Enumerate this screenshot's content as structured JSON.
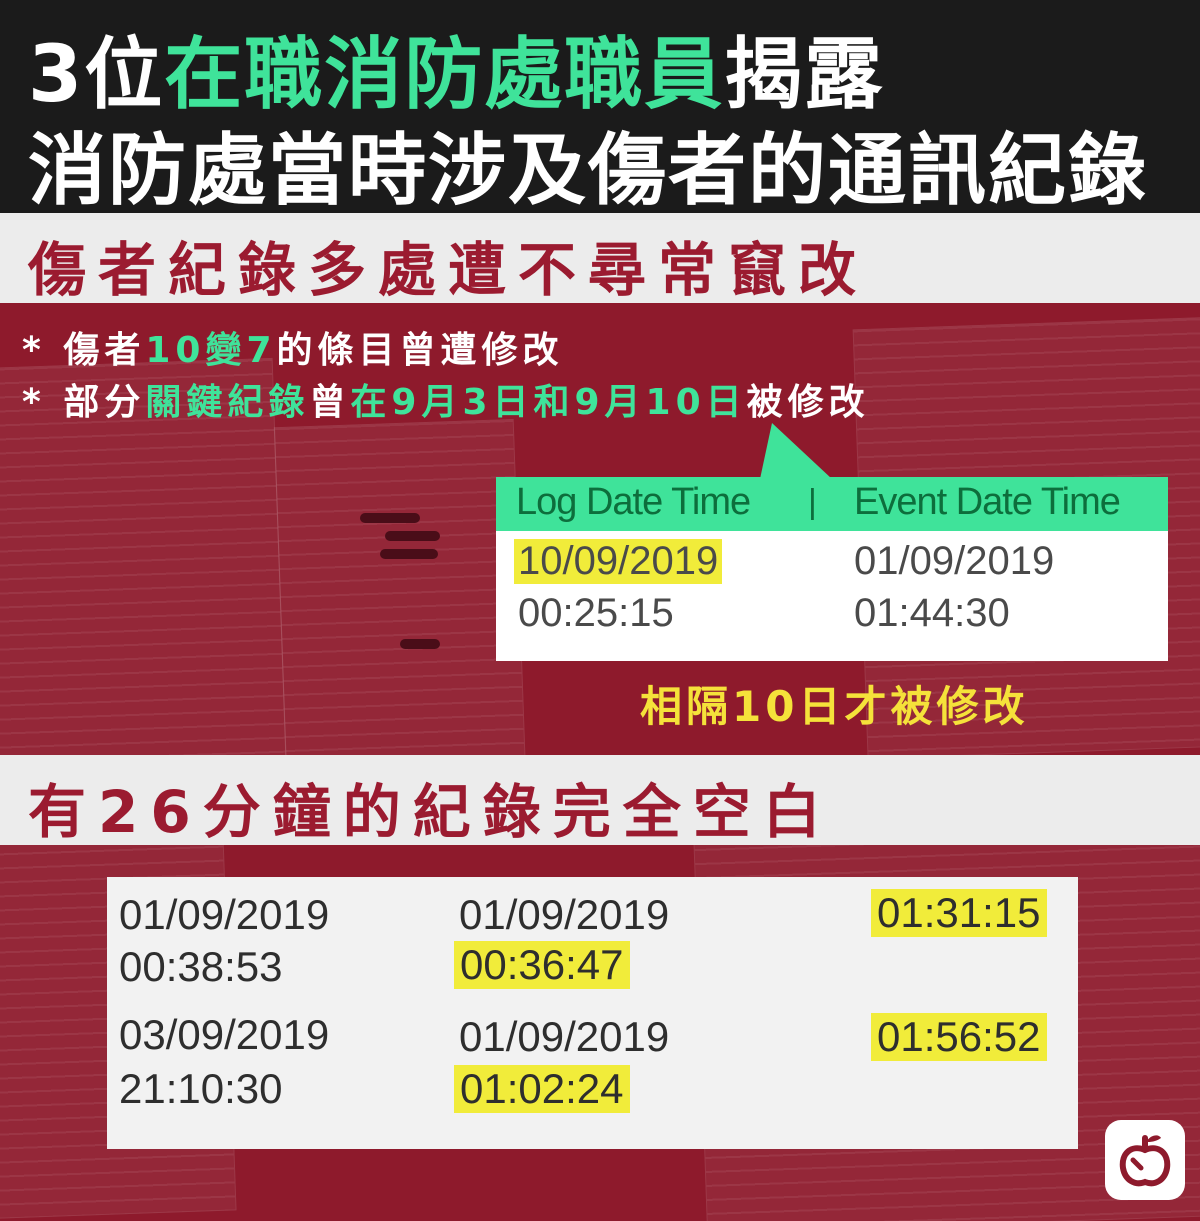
{
  "header": {
    "line1_a": "3位",
    "line1_b": "在職消防處職員",
    "line1_c": "揭露",
    "line2": "消防處當時涉及傷者的通訊紀錄"
  },
  "section1": {
    "band_title": "傷者紀錄多處遭不尋常竄改",
    "bullet1_a": "* 傷者",
    "bullet1_b": "10變7",
    "bullet1_c": "的條目曾遭修改",
    "bullet2_a": "* 部分",
    "bullet2_b": "關鍵紀錄",
    "bullet2_c": "曾",
    "bullet2_d": "在9月3日和9月10日",
    "bullet2_e": "被修改",
    "log_header_left": "Log Date Time",
    "log_header_sep": "|",
    "log_header_right": "Event Date Time",
    "log_date": "10/09/2019",
    "log_time": "00:25:15",
    "event_date": "01/09/2019",
    "event_time": "01:44:30",
    "caption": "相隔10日才被修改"
  },
  "section2": {
    "band_title": "有26分鐘的紀錄完全空白",
    "rows": [
      {
        "c1_date": "01/09/2019",
        "c1_time": "00:38:53",
        "c2_date": "01/09/2019",
        "c2_time": "00:36:47",
        "c3": "01:31:15"
      },
      {
        "c1_date": "03/09/2019",
        "c1_time": "21:10:30",
        "c2_date": "01/09/2019",
        "c2_time": "01:02:24",
        "c3": "01:56:52"
      }
    ]
  },
  "colors": {
    "accent_green": "#3fe39a",
    "red_bg": "#8e1a2c",
    "highlight": "#f1ec3a",
    "band_text": "#9b1b30"
  },
  "logo": {
    "icon": "apple-icon"
  }
}
